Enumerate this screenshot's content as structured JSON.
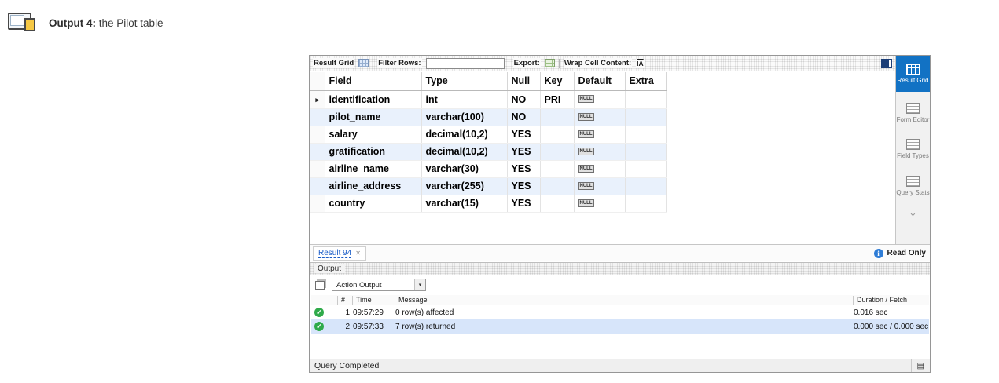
{
  "caption": {
    "title": "Output 4:",
    "subtitle": "the Pilot table"
  },
  "toolbar": {
    "result_grid_label": "Result Grid",
    "filter_rows_label": "Filter Rows:",
    "filter_value": "",
    "export_label": "Export:",
    "wrap_label": "Wrap Cell Content:",
    "wrap_glyph": "IA"
  },
  "grid": {
    "columns": [
      "Field",
      "Type",
      "Null",
      "Key",
      "Default",
      "Extra"
    ],
    "rows": [
      {
        "field": "identification",
        "type": "int",
        "null": "NO",
        "key": "PRI",
        "default": "NULL",
        "extra": ""
      },
      {
        "field": "pilot_name",
        "type": "varchar(100)",
        "null": "NO",
        "key": "",
        "default": "NULL",
        "extra": ""
      },
      {
        "field": "salary",
        "type": "decimal(10,2)",
        "null": "YES",
        "key": "",
        "default": "NULL",
        "extra": ""
      },
      {
        "field": "gratification",
        "type": "decimal(10,2)",
        "null": "YES",
        "key": "",
        "default": "NULL",
        "extra": ""
      },
      {
        "field": "airline_name",
        "type": "varchar(30)",
        "null": "YES",
        "key": "",
        "default": "NULL",
        "extra": ""
      },
      {
        "field": "airline_address",
        "type": "varchar(255)",
        "null": "YES",
        "key": "",
        "default": "NULL",
        "extra": ""
      },
      {
        "field": "country",
        "type": "varchar(15)",
        "null": "YES",
        "key": "",
        "default": "NULL",
        "extra": ""
      }
    ]
  },
  "result_tab": {
    "label": "Result 94"
  },
  "sidebar": {
    "items": [
      {
        "label": "Result Grid"
      },
      {
        "label": "Form Editor"
      },
      {
        "label": "Field Types"
      },
      {
        "label": "Query Stats"
      }
    ],
    "read_only": "Read Only"
  },
  "output": {
    "header": "Output",
    "selector_label": "Action Output",
    "table_headers": {
      "num": "#",
      "time": "Time",
      "message": "Message",
      "duration": "Duration / Fetch"
    },
    "rows": [
      {
        "num": "1",
        "time": "09:57:29",
        "message": "0 row(s) affected",
        "duration": "0.016 sec"
      },
      {
        "num": "2",
        "time": "09:57:33",
        "message": "7 row(s) returned",
        "duration": "0.000 sec / 0.000 sec"
      }
    ]
  },
  "status_bar": {
    "text": "Query Completed"
  },
  "glyphs": {
    "row_marker": "▸",
    "close": "✕",
    "dropdown": "▾",
    "chevron_down": "⌄",
    "check": "✓",
    "info": "i",
    "list": "▤"
  },
  "colors": {
    "accent_blue": "#1272c4",
    "success_green": "#2faa4a",
    "row_stripe": "#e9f1fc",
    "link_blue": "#1a5dc8"
  }
}
